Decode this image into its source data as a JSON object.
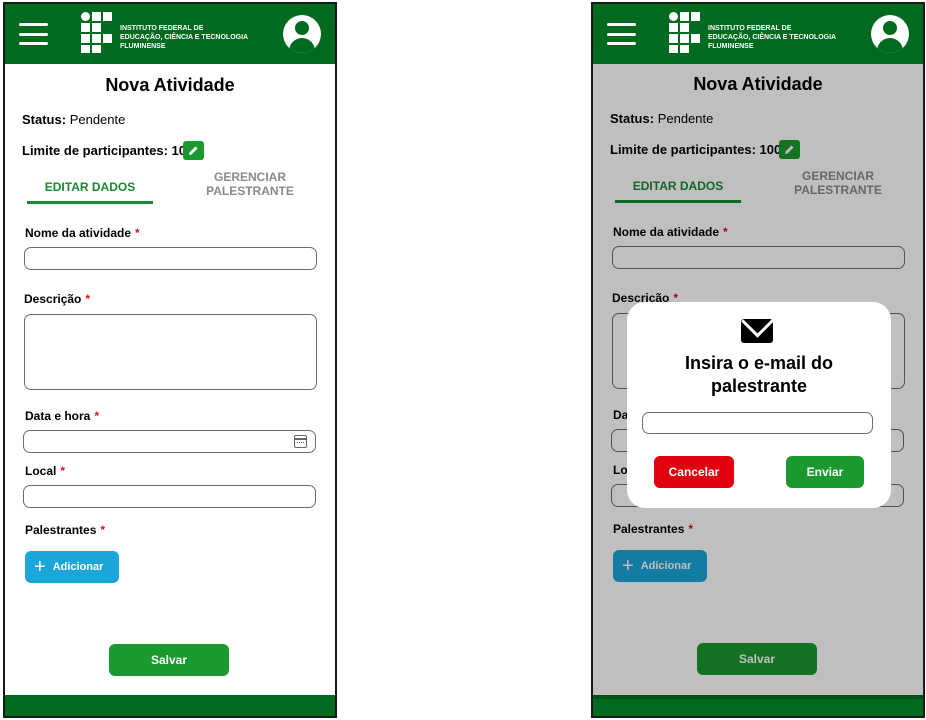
{
  "header": {
    "logo_line1": "INSTITUTO FEDERAL DE",
    "logo_line2": "EDUCAÇÃO, CIÊNCIA E TECNOLOGIA",
    "logo_line3": "FLUMINENSE"
  },
  "screens": [
    {
      "title": "Nova Atividade",
      "status_label": "Status:",
      "status_value": "Pendente",
      "limit_label": "Limite de participantes:",
      "limit_value": "10",
      "tabs": {
        "active": "EDITAR DADOS",
        "inactive_line1": "GERENCIAR",
        "inactive_line2": "PALESTRANTE"
      },
      "fields": {
        "activity_name": {
          "label": "Nome da atividade",
          "value": ""
        },
        "description": {
          "label": "Descrição",
          "value": ""
        },
        "datetime": {
          "label": "Data e hora",
          "value": ""
        },
        "location": {
          "label": "Local",
          "value": ""
        },
        "speakers": {
          "label": "Palestrantes"
        }
      },
      "required_mark": "*",
      "add_button": "Adicionar",
      "add_plus": "+",
      "save_button": "Salvar"
    },
    {
      "title": "Nova Atividade",
      "status_label": "Status:",
      "status_value": "Pendente",
      "limit_label": "Limite de participantes:",
      "limit_value": "100",
      "tabs": {
        "active": "EDITAR DADOS",
        "inactive_line1": "GERENCIAR",
        "inactive_line2": "PALESTRANTE"
      },
      "fields": {
        "activity_name": {
          "label": "Nome da atividade",
          "value": ""
        },
        "description": {
          "label": "Descrição",
          "value": ""
        },
        "datetime": {
          "label": "Da",
          "value": ""
        },
        "location": {
          "label": "Lo",
          "value": ""
        },
        "speakers": {
          "label": "Palestrantes"
        }
      },
      "required_mark": "*",
      "add_button": "Adicionar",
      "add_plus": "+",
      "save_button": "Salvar",
      "modal": {
        "title_line1": "Insira o e-mail do",
        "title_line2": "palestrante",
        "email_value": "",
        "cancel_button": "Cancelar",
        "send_button": "Enviar"
      }
    }
  ],
  "colors": {
    "header_green": "#006b1f",
    "button_green": "#1a9a2e",
    "button_blue": "#1aa6d8",
    "cancel_red": "#e00010",
    "required_red": "#dd1111"
  }
}
